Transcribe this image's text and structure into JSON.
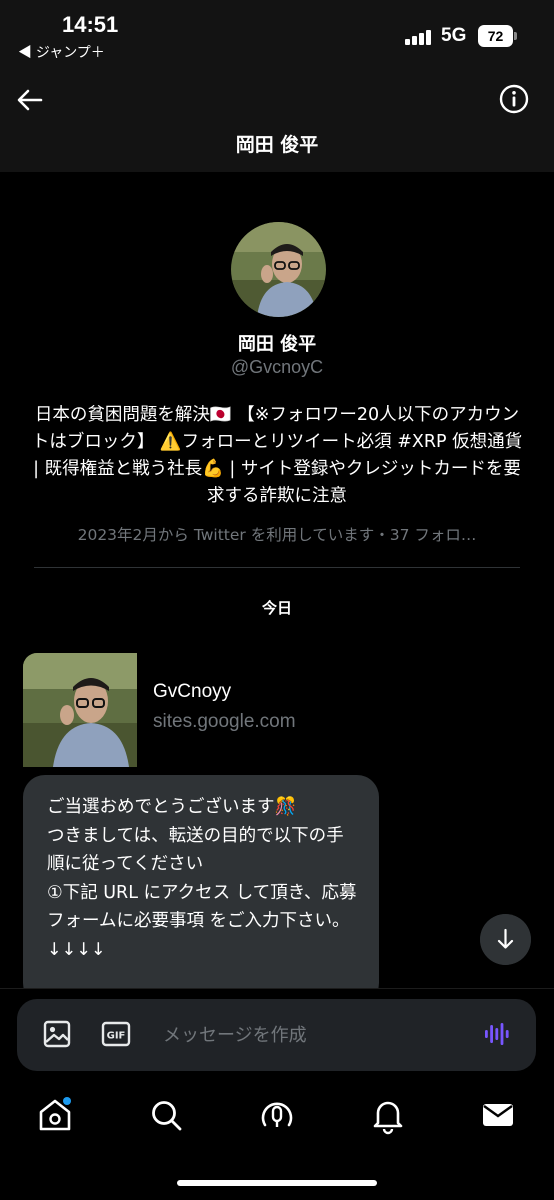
{
  "status_bar": {
    "time": "14:51",
    "back_app": "◀ ジャンプ＋",
    "network": "5G",
    "battery": "72"
  },
  "header": {
    "title": "岡田 俊平"
  },
  "profile": {
    "name": "岡田 俊平",
    "handle": "@GvcnoyC",
    "bio": "日本の貧困問題を解決🇯🇵 【※フォロワー20人以下のアカウントはブロック】 ⚠️フォローとリツイート必須 #XRP 仮想通貨 | 既得権益と戦う社長💪 | サイト登録やクレジットカードを要求する詐欺に注意",
    "joined": "2023年2月から Twitter を利用しています・37 フォロ…"
  },
  "conversation": {
    "day_label": "今日",
    "link_card": {
      "title": "GvCnoyy",
      "domain": "sites.google.com"
    },
    "message": "ご当選おめでとうございます🎊\nつきましては、転送の目的で以下の手順に従ってください\n①下記 URL にアクセス して頂き、応募フォームに必要事項 をご入力下さい。\n↓↓↓↓"
  },
  "composer": {
    "placeholder": "メッセージを作成",
    "gif_label": "GIF"
  },
  "tabs": [
    {
      "icon": "home-icon"
    },
    {
      "icon": "search-icon"
    },
    {
      "icon": "spaces-icon"
    },
    {
      "icon": "notifications-icon"
    },
    {
      "icon": "messages-icon"
    }
  ],
  "colors": {
    "background": "#000000",
    "header": "#131313",
    "bubble": "#2f3336",
    "muted_text": "#71767b",
    "accent": "#1d9bf0",
    "voice": "#7856ff"
  }
}
